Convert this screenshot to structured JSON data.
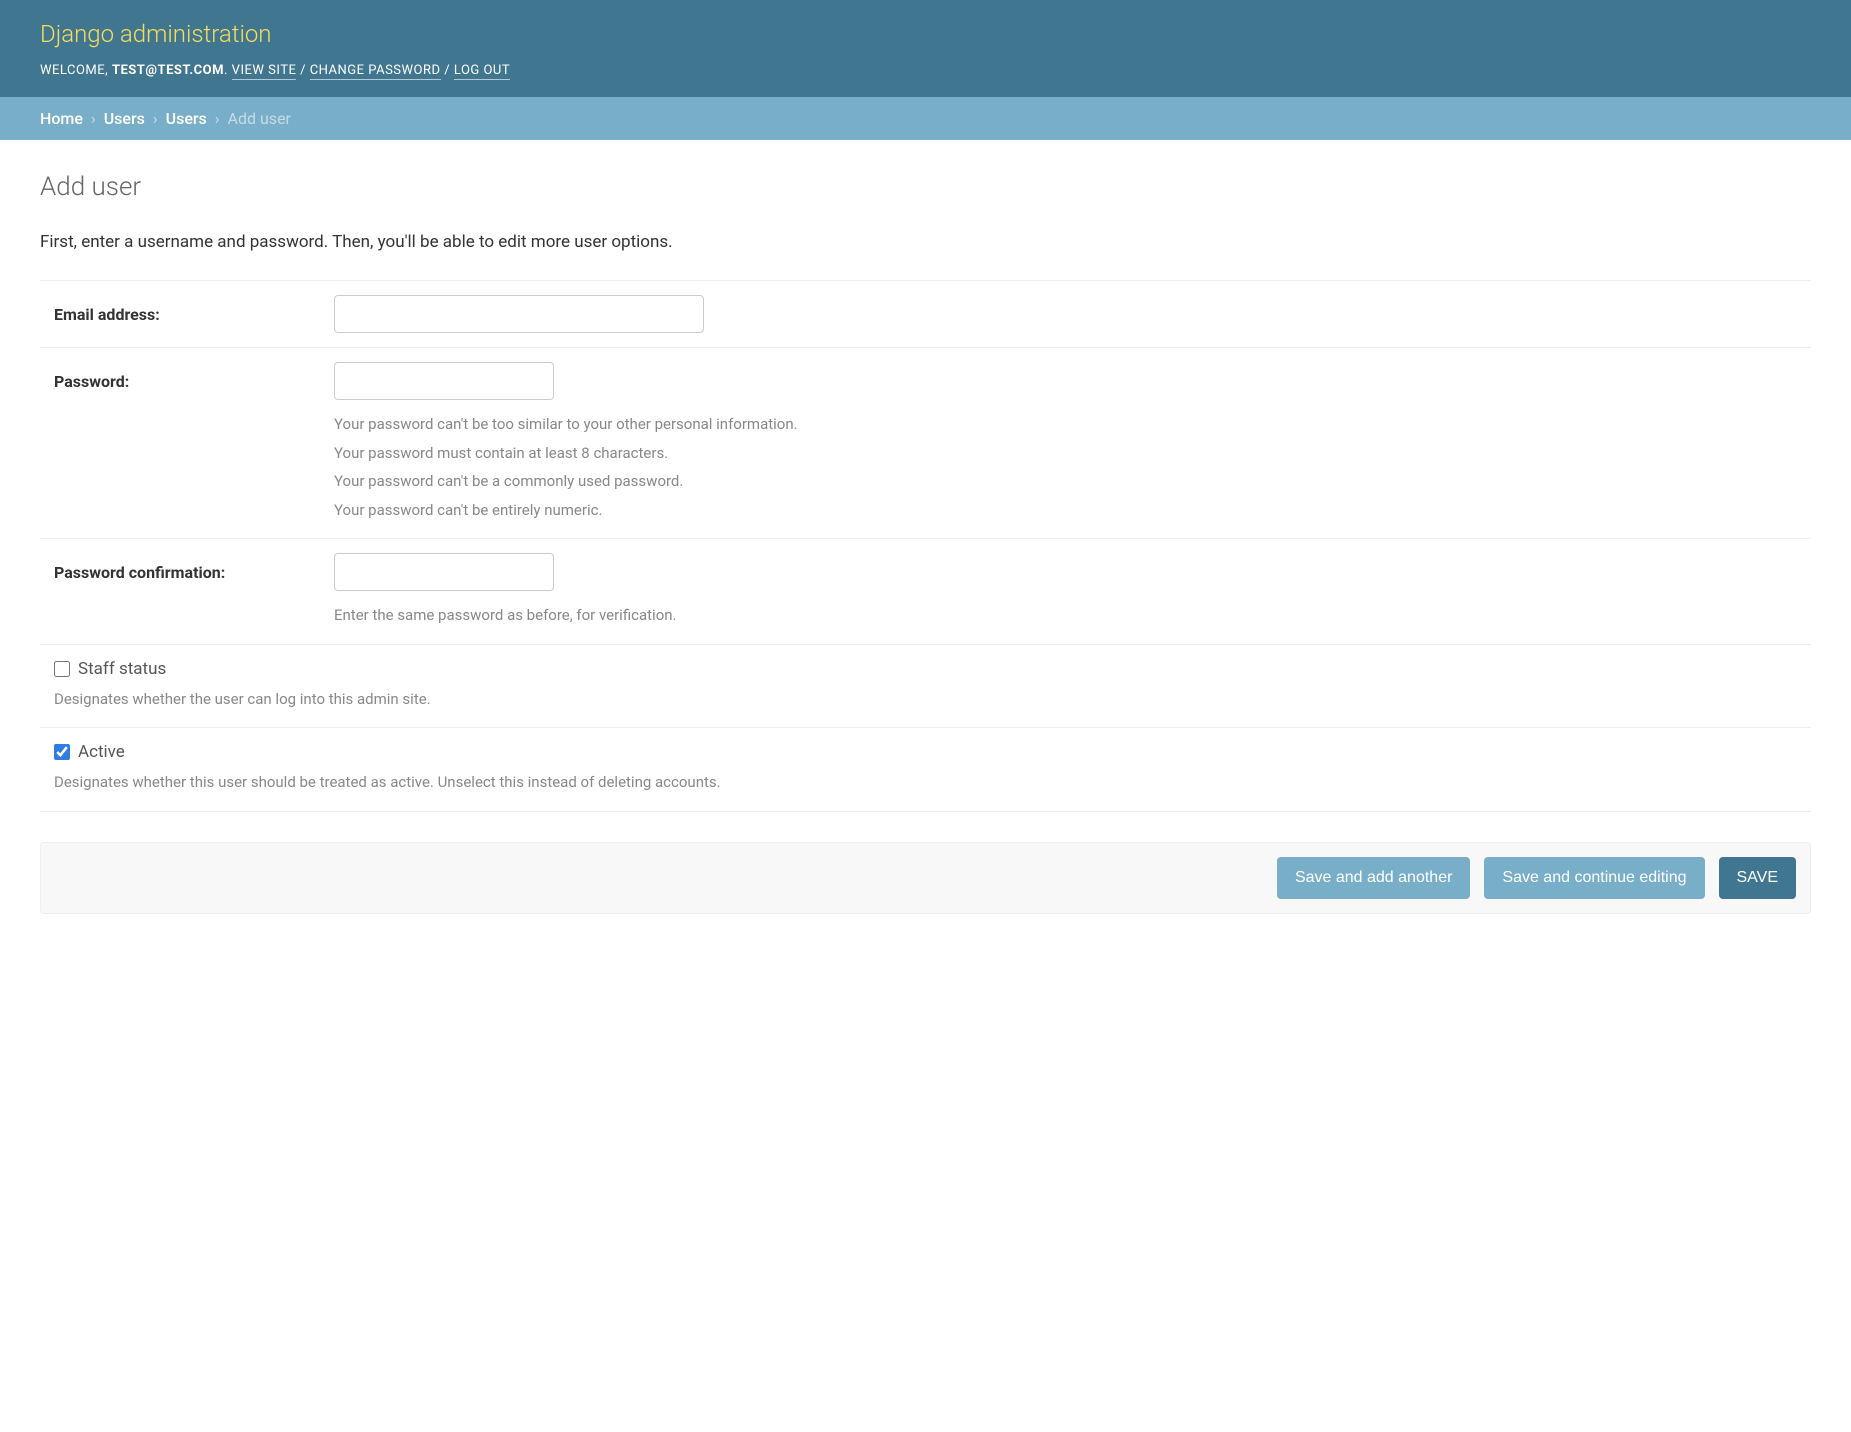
{
  "header": {
    "site_title": "Django administration",
    "welcome_prefix": "Welcome, ",
    "username": "TEST@TEST.COM",
    "view_site": "View site",
    "change_password": "Change password",
    "log_out": "Log out"
  },
  "breadcrumbs": {
    "home": "Home",
    "app": "Users",
    "model": "Users",
    "current": "Add user"
  },
  "page": {
    "title": "Add user",
    "intro": "First, enter a username and password. Then, you'll be able to edit more user options."
  },
  "form": {
    "email": {
      "label": "Email address:",
      "value": ""
    },
    "password": {
      "label": "Password:",
      "value": "",
      "help": [
        "Your password can't be too similar to your other personal information.",
        "Your password must contain at least 8 characters.",
        "Your password can't be a commonly used password.",
        "Your password can't be entirely numeric."
      ]
    },
    "password_confirm": {
      "label": "Password confirmation:",
      "value": "",
      "help": "Enter the same password as before, for verification."
    },
    "staff_status": {
      "label": "Staff status",
      "checked": false,
      "help": "Designates whether the user can log into this admin site."
    },
    "active": {
      "label": "Active",
      "checked": true,
      "help": "Designates whether this user should be treated as active. Unselect this instead of deleting accounts."
    }
  },
  "buttons": {
    "save_add_another": "Save and add another",
    "save_continue": "Save and continue editing",
    "save": "SAVE"
  }
}
